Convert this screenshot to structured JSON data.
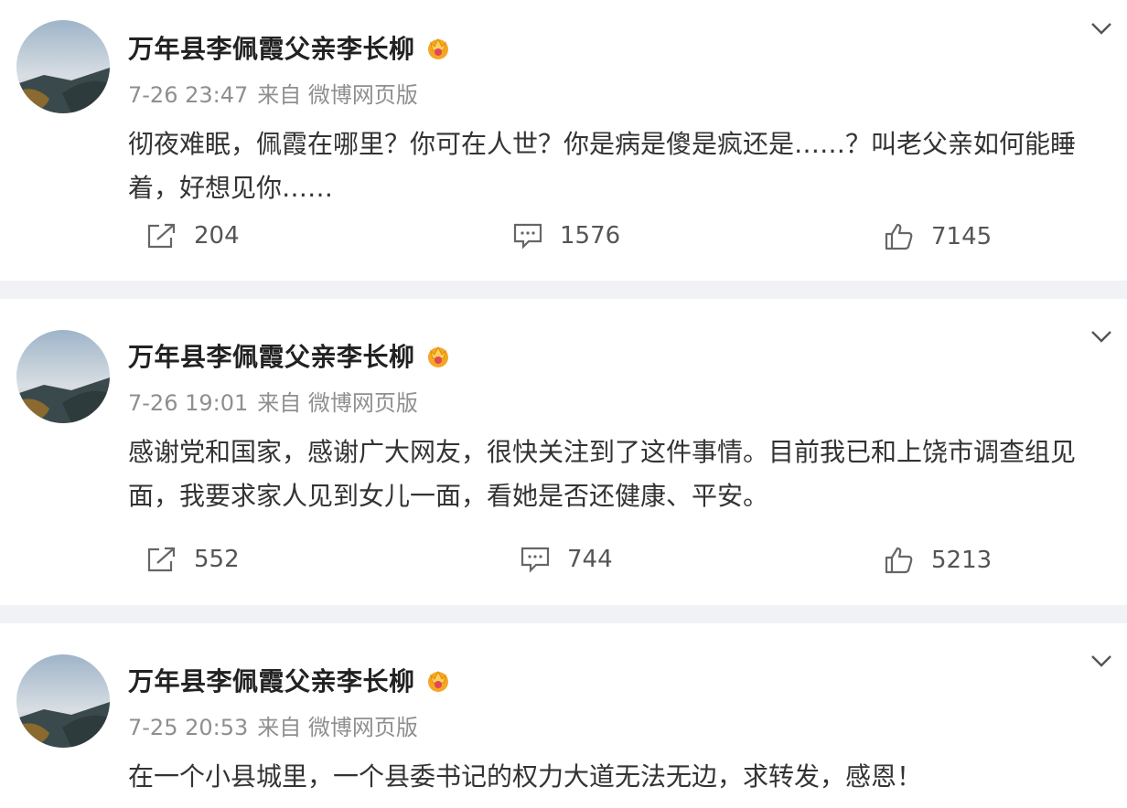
{
  "posts": [
    {
      "author": "万年县李佩霞父亲李长柳",
      "time": "7-26 23:47",
      "source": "来自 微博网页版",
      "text": "彻夜难眠，佩霞在哪里？你可在人世？你是病是傻是疯还是……？叫老父亲如何能睡着，好想见你……",
      "reposts": "204",
      "comments": "1576",
      "likes": "7145"
    },
    {
      "author": "万年县李佩霞父亲李长柳",
      "time": "7-26 19:01",
      "source": "来自 微博网页版",
      "text": "感谢党和国家，感谢广大网友，很快关注到了这件事情。目前我已和上饶市调查组见面，我要求家人见到女儿一面，看她是否还健康、平安。",
      "reposts": "552",
      "comments": "744",
      "likes": "5213"
    },
    {
      "author": "万年县李佩霞父亲李长柳",
      "time": "7-25 20:53",
      "source": "来自 微博网页版",
      "text": "在一个小县城里，一个县委书记的权力大道无法无边，求转发，感恩！"
    }
  ],
  "icons": {
    "repost": "repost-icon",
    "comment": "comment-icon",
    "like": "thumbs-up-icon",
    "vip": "vip-crown-icon",
    "menu": "chevron-down-icon"
  },
  "colors": {
    "vip": "#f5a623",
    "text": "#333333",
    "meta": "#8f8f8f"
  }
}
